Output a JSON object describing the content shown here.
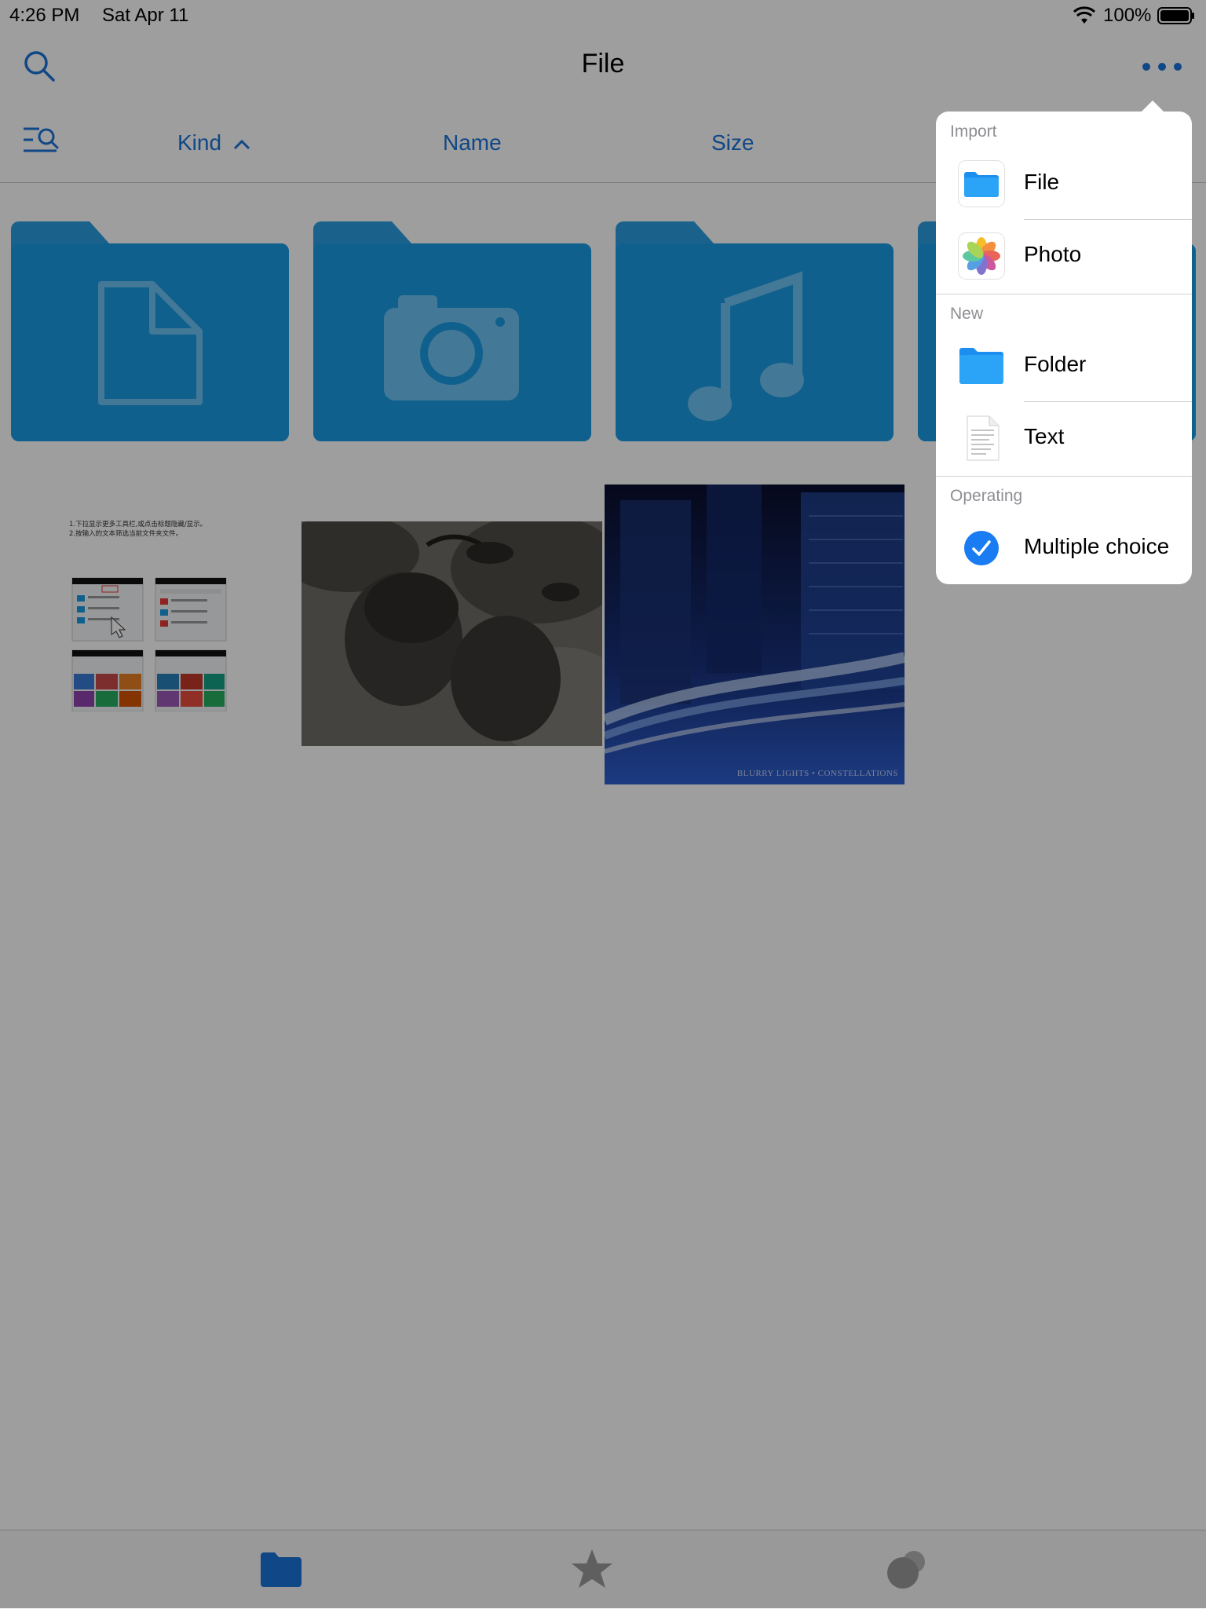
{
  "status": {
    "time": "4:26 PM",
    "date": "Sat Apr 11",
    "battery": "100%"
  },
  "nav": {
    "title": "File"
  },
  "sort": {
    "kind": "Kind",
    "name": "Name",
    "size": "Size"
  },
  "thumbs": {
    "doc_line1": "1.下拉显示更多工具栏,或点击标题隐藏/显示。",
    "doc_line2": "2.按输入的文本筛选当前文件夹文件。",
    "city_caption": "BLURRY LIGHTS • CONSTELLATIONS"
  },
  "menu": {
    "import_header": "Import",
    "file_label": "File",
    "photo_label": "Photo",
    "new_header": "New",
    "folder_label": "Folder",
    "text_label": "Text",
    "operating_header": "Operating",
    "multiple_label": "Multiple choice"
  },
  "colors": {
    "accent": "#1a73d9",
    "folder": "#1a9be6",
    "dim_overlay": "rgba(0,0,0,0.38)"
  }
}
